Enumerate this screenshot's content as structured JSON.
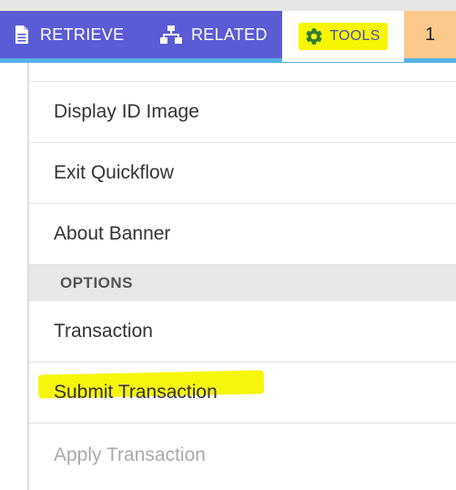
{
  "nav": {
    "retrieve_label": "RETRIEVE",
    "related_label": "RELATED",
    "tools_label": "TOOLS",
    "count": "1"
  },
  "menu": {
    "items": [
      {
        "label": "Display ID Image"
      },
      {
        "label": "Exit Quickflow"
      },
      {
        "label": "About Banner"
      }
    ],
    "options_header": "OPTIONS",
    "options_items": [
      {
        "label": "Transaction"
      },
      {
        "label": "Submit Transaction"
      },
      {
        "label": "Apply Transaction"
      }
    ]
  },
  "colors": {
    "navbar": "#5b5bd6",
    "navbar_underline": "#54b2e6",
    "highlight": "#f6f600",
    "count_badge": "#fbc98b",
    "disabled_text": "#aaaaaa"
  },
  "icons": {
    "retrieve": "document-icon",
    "related": "sitemap-icon",
    "tools": "gear-icon"
  }
}
